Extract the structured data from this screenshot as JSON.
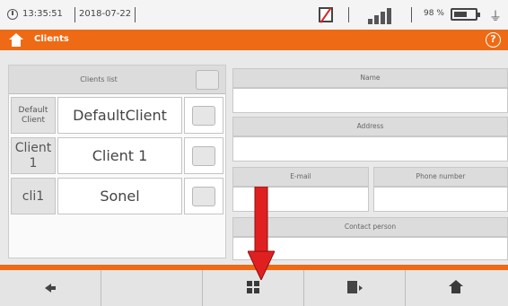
{
  "status_bar": {
    "time": "13:35:51",
    "date": "2018-07-22",
    "battery_percent": "98 %",
    "icons": [
      "clock-icon",
      "no-memory-card-icon",
      "signal-icon",
      "battery-icon",
      "plug-icon"
    ]
  },
  "title_bar": {
    "title": "Clients",
    "icons": [
      "home-icon",
      "help-icon"
    ],
    "accent_color": "#ef6a14"
  },
  "clients_list": {
    "header": "Clients list",
    "rows": [
      {
        "code": "Default Client",
        "name": "DefaultClient"
      },
      {
        "code": "Client 1",
        "name": "Client 1"
      },
      {
        "code": "cli1",
        "name": "Sonel"
      }
    ]
  },
  "details": {
    "name_label": "Name",
    "address_label": "Address",
    "email_label": "E-mail",
    "phone_label": "Phone number",
    "contact_label": "Contact person"
  },
  "toolbar": {
    "buttons": [
      "back-icon",
      "empty",
      "grid-icon",
      "export-icon",
      "home-icon"
    ]
  },
  "annotation": {
    "arrow_color": "#e02020"
  }
}
